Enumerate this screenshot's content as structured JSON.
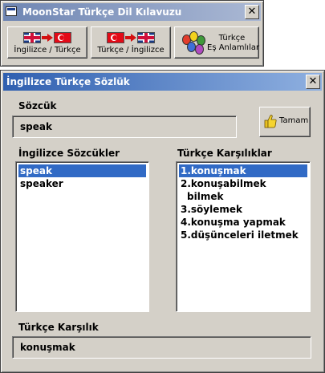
{
  "main_window": {
    "title": "MoonStar Türkçe Dil Kılavuzu",
    "close_glyph": "✕",
    "buttons": [
      {
        "label": "İngilizce / Türkçe",
        "icon": "uk-to-tr-flags-icon"
      },
      {
        "label": "Türkçe / İngilizce",
        "icon": "tr-to-uk-flags-icon"
      },
      {
        "label_line1": "Türkçe",
        "label_line2": "Eş Anlamlılar",
        "icon": "balloons-icon"
      }
    ]
  },
  "dialog": {
    "title": "İngilizce Türkçe Sözlük",
    "close_glyph": "✕",
    "word_label": "Sözcük",
    "word_value": "speak",
    "ok_button": "Tamam",
    "english_words_label": "İngilizce Sözcükler",
    "english_words": [
      {
        "text": "speak",
        "selected": true
      },
      {
        "text": "speaker",
        "selected": false
      }
    ],
    "turkish_meanings_label": "Türkçe Karşılıklar",
    "turkish_meanings": [
      {
        "text": "1.konuşmak",
        "selected": true,
        "continuation": false
      },
      {
        "text": "2.konuşabilmek",
        "selected": false,
        "continuation": false
      },
      {
        "text": "bilmek",
        "selected": false,
        "continuation": true
      },
      {
        "text": "3.söylemek",
        "selected": false,
        "continuation": false
      },
      {
        "text": "4.konuşma yapmak",
        "selected": false,
        "continuation": false
      },
      {
        "text": "5.düşünceleri iletmek",
        "selected": false,
        "continuation": false
      }
    ],
    "result_label": "Türkçe Karşılık",
    "result_value": "konuşmak"
  },
  "colors": {
    "face": "#d4d0c8",
    "selection": "#316ac5",
    "active_title": "#2f5fb0",
    "inactive_title": "#6f86b3"
  }
}
